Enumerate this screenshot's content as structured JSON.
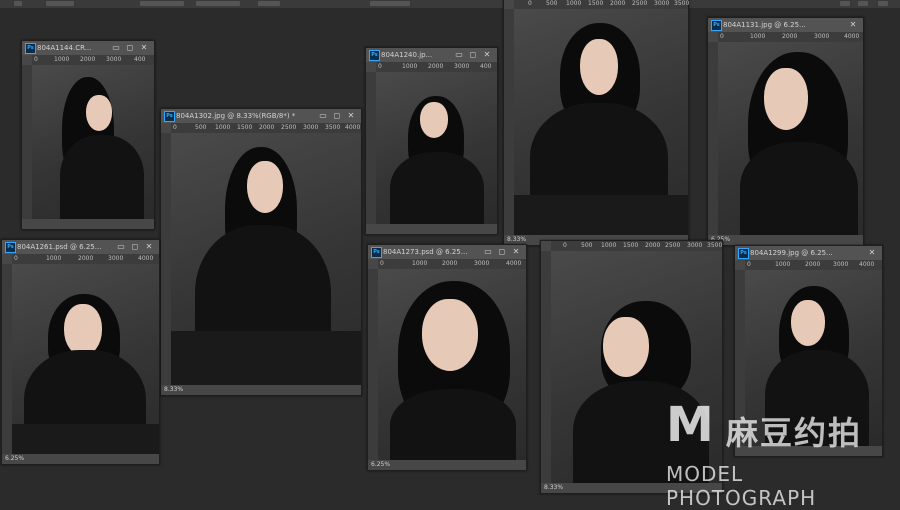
{
  "app": {
    "name": "Photoshop"
  },
  "windows": [
    {
      "id": "w1",
      "name": "804A1144.CR...",
      "ruler": [
        "0",
        "1000",
        "2000",
        "3000",
        "400"
      ],
      "status": ""
    },
    {
      "id": "w2",
      "name": "804A1302.jpg @ 8.33%(RGB/8*) *",
      "ruler": [
        "0",
        "500",
        "1000",
        "1500",
        "2000",
        "2500",
        "3000",
        "3500",
        "4000"
      ],
      "status": "8.33%"
    },
    {
      "id": "w3",
      "name": "804A1240.jp...",
      "ruler": [
        "0",
        "1000",
        "2000",
        "3000",
        "400"
      ],
      "status": ""
    },
    {
      "id": "w4",
      "name": "",
      "ruler": [
        "0",
        "500",
        "1000",
        "1500",
        "2000",
        "2500",
        "3000",
        "3500"
      ],
      "status": "8.33%"
    },
    {
      "id": "w5",
      "name": "804A1131.jpg @ 6.25...",
      "ruler": [
        "0",
        "1000",
        "2000",
        "3000",
        "4000"
      ],
      "status": "6.25%"
    },
    {
      "id": "w6",
      "name": "804A1261.psd @ 6.25...",
      "ruler": [
        "0",
        "1000",
        "2000",
        "3000",
        "4000"
      ],
      "status": "6.25%"
    },
    {
      "id": "w7",
      "name": "804A1273.psd @ 6.25...",
      "ruler": [
        "0",
        "1000",
        "2000",
        "3000",
        "4000"
      ],
      "status": "6.25%"
    },
    {
      "id": "w8",
      "name": "",
      "ruler": [
        "0",
        "500",
        "1000",
        "1500",
        "2000",
        "2500",
        "3000",
        "3500"
      ],
      "status": "8.33%"
    },
    {
      "id": "w9",
      "name": "804A1299.jpg @ 6.25...",
      "ruler": [
        "0",
        "1000",
        "2000",
        "3000",
        "4000"
      ],
      "status": ""
    }
  ],
  "icons": {
    "ps": "Ps",
    "minimize": "▭",
    "restore": "◻",
    "close": "✕"
  },
  "watermark": {
    "mark": "M",
    "chinese": "麻豆约拍",
    "english": "MODEL PHOTOGRAPH"
  }
}
